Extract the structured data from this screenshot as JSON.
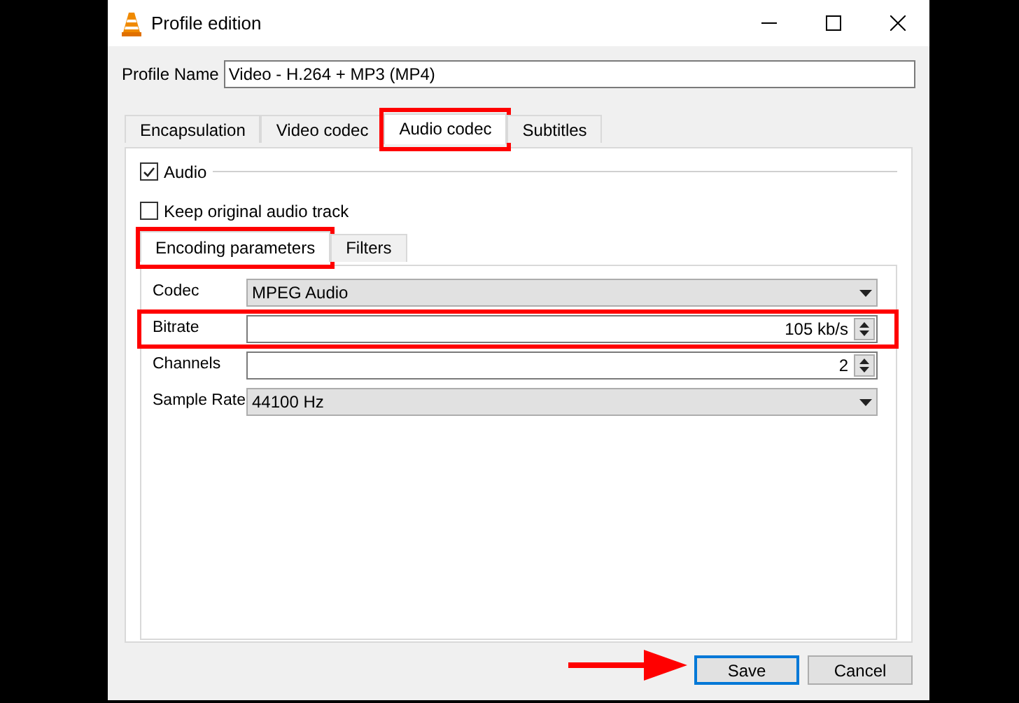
{
  "window": {
    "title": "Profile edition"
  },
  "profile_name": {
    "label": "Profile Name",
    "value": "Video - H.264 + MP3 (MP4)"
  },
  "tabs": [
    {
      "label": "Encapsulation",
      "selected": false,
      "highlighted": false
    },
    {
      "label": "Video codec",
      "selected": false,
      "highlighted": false
    },
    {
      "label": "Audio codec",
      "selected": true,
      "highlighted": true
    },
    {
      "label": "Subtitles",
      "selected": false,
      "highlighted": false
    }
  ],
  "audio": {
    "label": "Audio",
    "checked": true
  },
  "keep_original": {
    "label": "Keep original audio track",
    "checked": false
  },
  "subtabs": [
    {
      "label": "Encoding parameters",
      "selected": true,
      "highlighted": true
    },
    {
      "label": "Filters",
      "selected": false,
      "highlighted": false
    }
  ],
  "fields": [
    {
      "kind": "dropdown",
      "label": "Codec",
      "value": "MPEG Audio",
      "highlighted": false
    },
    {
      "kind": "spinner",
      "label": "Bitrate",
      "value": "105 kb/s",
      "highlighted": true
    },
    {
      "kind": "spinner",
      "label": "Channels",
      "value": "2",
      "highlighted": false
    },
    {
      "kind": "dropdown",
      "label": "Sample Rate",
      "value": "44100 Hz",
      "highlighted": false
    }
  ],
  "buttons": [
    {
      "label": "Save",
      "default": true,
      "pointed": true
    },
    {
      "label": "Cancel",
      "default": false,
      "pointed": false
    }
  ]
}
